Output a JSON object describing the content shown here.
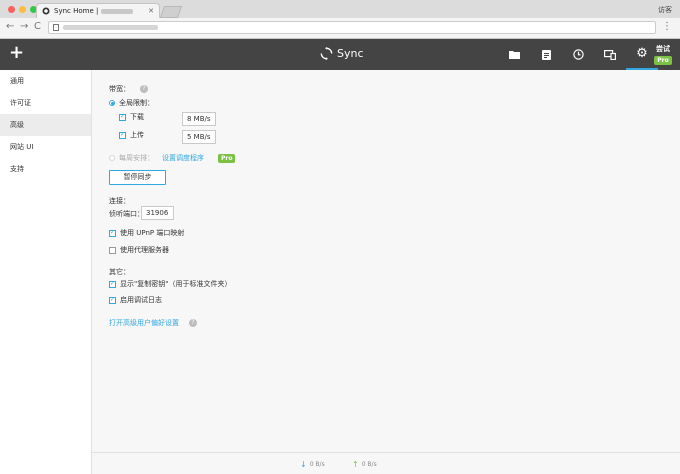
{
  "browser": {
    "tab_title": "Sync Home | ",
    "guest_label": "访客",
    "back": "←",
    "forward": "→",
    "reload": "C",
    "menu": "⋮"
  },
  "app": {
    "brand": "Sync",
    "trial_label": "尝试",
    "trial_badge": "Pro",
    "accent": "#31a8e0"
  },
  "sidebar": {
    "items": [
      {
        "label": "通用"
      },
      {
        "label": "许可证"
      },
      {
        "label": "高级"
      },
      {
        "label": "网站 UI"
      },
      {
        "label": "支持"
      }
    ]
  },
  "bandwidth": {
    "heading": "带宽：",
    "global_limit": "全局限制：",
    "download_label": "下载",
    "download_value": "8 MB/s",
    "upload_label": "上传",
    "upload_value": "5 MB/s",
    "weekly_label": "每周安排：",
    "scheduler_link": "设置调度程序",
    "pro_badge": "Pro",
    "pause_button": "暂停同步"
  },
  "connection": {
    "heading": "连接：",
    "port_label": "侦听端口：",
    "port_value": "31906",
    "upnp_label": "使用 UPnP 端口映射",
    "proxy_label": "使用代理服务器"
  },
  "other": {
    "heading": "其它：",
    "copy_link_label": "显示\"复制密钥\"（用于标准文件夹）",
    "debug_log_label": "启用调试日志",
    "advanced_link": "打开高级用户偏好设置"
  },
  "footer": {
    "download_rate": "0 B/s",
    "upload_rate": "0 B/s"
  }
}
